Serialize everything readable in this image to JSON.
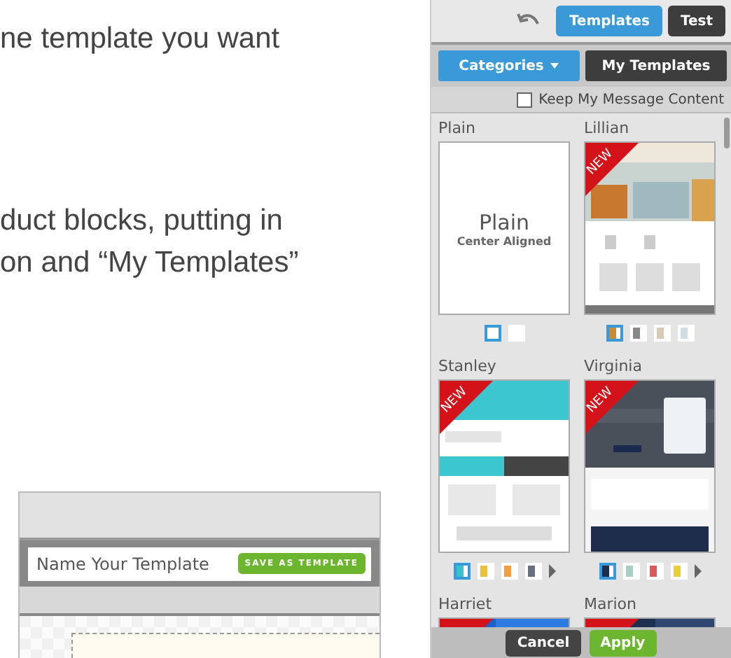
{
  "article": {
    "lines": [
      "ne template you want",
      "duct blocks, putting in",
      "on and “My Templates”"
    ],
    "save_box": {
      "placeholder": "Name Your Template",
      "button": "SAVE AS TEMPLATE"
    }
  },
  "panel": {
    "tabs": [
      {
        "label": "Templates",
        "selected": true
      },
      {
        "label": "Test",
        "selected": false
      }
    ],
    "filters": [
      {
        "label": "Categories",
        "selected": true,
        "dropdown": true
      },
      {
        "label": "My Templates",
        "selected": false,
        "dropdown": false
      }
    ],
    "keep_content": {
      "label": "Keep My Message Content",
      "checked": false
    },
    "templates": [
      {
        "name": "Plain",
        "kind": "text",
        "title": "Plain",
        "subtitle": "Center Aligned",
        "swatches": [
          {
            "color": "#ffffff",
            "selected": true
          },
          {
            "color": "#ffffff",
            "selected": false
          }
        ]
      },
      {
        "name": "Lillian",
        "kind": "picture",
        "ribbon": true,
        "ribbon_text": "NEW",
        "swatches": [
          {
            "color": "#c98a3a",
            "selected": true
          },
          {
            "color": "#888888",
            "selected": false
          },
          {
            "color": "#d8cbb5",
            "selected": false
          },
          {
            "color": "#cfdde3",
            "selected": false
          }
        ]
      },
      {
        "name": "Stanley",
        "kind": "picture",
        "ribbon": true,
        "ribbon_text": "NEW",
        "more": true,
        "swatches": [
          {
            "color": "#3cc0cc",
            "selected": true
          },
          {
            "color": "#e8c23a",
            "selected": false
          },
          {
            "color": "#f0a040",
            "selected": false
          },
          {
            "color": "#6a6f80",
            "selected": false
          }
        ]
      },
      {
        "name": "Virginia",
        "kind": "picture",
        "ribbon": true,
        "ribbon_text": "NEW",
        "more": true,
        "swatches": [
          {
            "color": "#1e2e4a",
            "selected": true
          },
          {
            "color": "#a8d0c0",
            "selected": false
          },
          {
            "color": "#d85a5a",
            "selected": false
          },
          {
            "color": "#e8d040",
            "selected": false
          }
        ]
      },
      {
        "name": "Harriet",
        "kind": "picture",
        "ribbon": true
      },
      {
        "name": "Marion",
        "kind": "picture",
        "ribbon": true
      }
    ],
    "buttons": [
      {
        "label": "Cancel",
        "kind": "secondary"
      },
      {
        "label": "Apply",
        "kind": "primary"
      }
    ]
  }
}
